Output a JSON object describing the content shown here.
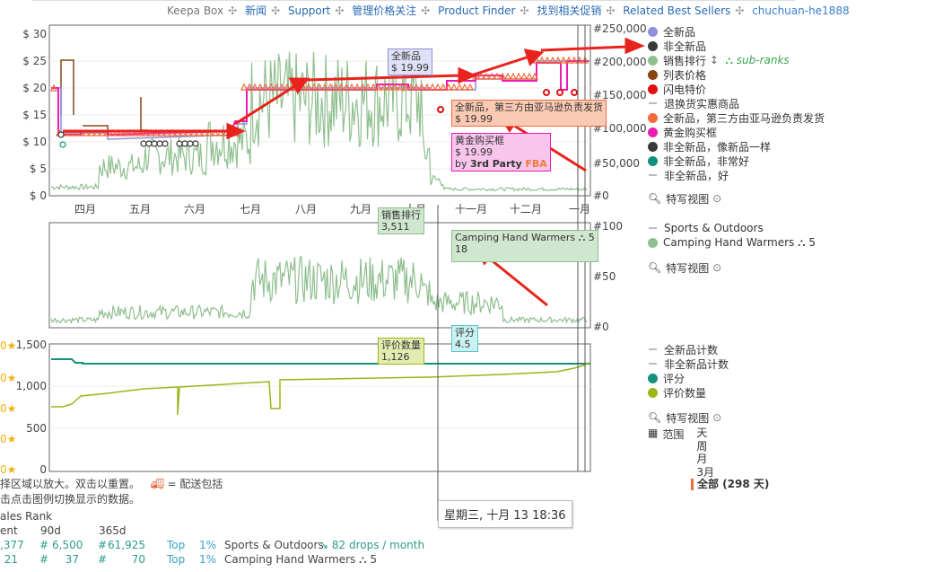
{
  "nav": {
    "items": [
      "Keepa Box",
      "新闻",
      "Support",
      "管理价格关注",
      "Product Finder",
      "找到相关促销",
      "Related Best Sellers",
      "chuchuan-he1888"
    ],
    "separator": "✣"
  },
  "price_chart": {
    "y_left": [
      "$ 30",
      "$ 25",
      "$ 20",
      "$ 15",
      "$ 10",
      "$ 5",
      "$ 0"
    ],
    "y_right": [
      "#250,000",
      "#200,000",
      "#150,000",
      "#100,000",
      "#50,000",
      "#0"
    ],
    "months": [
      "四月",
      "五月",
      "六月",
      "七月",
      "八月",
      "九月",
      "十月",
      "十一月",
      "十二月",
      "一月"
    ]
  },
  "rank_chart": {
    "y_right": [
      "#100",
      "#50",
      "#0"
    ]
  },
  "rating_chart": {
    "y_left": [
      "1,500",
      "1,000",
      "500",
      "0"
    ]
  },
  "tooltips": {
    "new": {
      "title": "全新品",
      "value": "$ 19.99"
    },
    "fba": {
      "title": "全新品，第三方由亚马逊负责发货",
      "value": "$ 19.99"
    },
    "buybox": {
      "title": "黄金购买框",
      "value": "$ 19.99",
      "by": "by",
      "seller": "3rd Party",
      "fba": "FBA"
    },
    "sales_rank": {
      "title": "销售排行",
      "value": "3,511"
    },
    "category": {
      "title": "Camping Hand Warmers",
      "value": "18",
      "sub": "5"
    },
    "rating": {
      "title": "评分",
      "value": "4.5"
    },
    "review_count": {
      "title": "评价数量",
      "value": "1,126"
    },
    "date": "星期三, 十月 13 18:36"
  },
  "legend_price": [
    {
      "label": "全新品",
      "color": "#8f8fdb",
      "type": "dot"
    },
    {
      "label": "非全新品",
      "color": "#3a3a3a",
      "type": "dot"
    },
    {
      "label": "销售排行",
      "color": "#8fbf8f",
      "type": "dot",
      "extra": "sub-ranks"
    },
    {
      "label": "列表价格",
      "color": "#8b4513",
      "type": "dot"
    },
    {
      "label": "闪电特价",
      "color": "#e01010",
      "type": "dot"
    },
    {
      "label": "退换货实惠商品",
      "type": "dash"
    },
    {
      "label": "全新品，第三方由亚马逊负责发货",
      "color": "#f26b3a",
      "type": "dot"
    },
    {
      "label": "黄金购买框",
      "color": "#ee1bb2",
      "type": "dot"
    },
    {
      "label": "非全新品，像新品一样",
      "color": "#3a3a3a",
      "type": "dot"
    },
    {
      "label": "非全新品，非常好",
      "color": "#10907a",
      "type": "dot"
    },
    {
      "label": "非全新品，好",
      "type": "dash"
    }
  ],
  "legend_rank": [
    {
      "label": "Sports & Outdoors",
      "type": "dash"
    },
    {
      "label": "Camping Hand Warmers",
      "color": "#8fbf8f",
      "type": "dot",
      "sub": "5"
    }
  ],
  "legend_rating": [
    {
      "label": "全新品计数",
      "type": "dash"
    },
    {
      "label": "非全新品计数",
      "type": "dash"
    },
    {
      "label": "评分",
      "color": "#14907c",
      "type": "dot"
    },
    {
      "label": "评价数量",
      "color": "#9bb51a",
      "type": "dot"
    }
  ],
  "close_up": "特写视图",
  "range": {
    "label": "范围",
    "options": [
      "天",
      "周",
      "月",
      "3月"
    ],
    "selected": "全部 (298 天)"
  },
  "help": {
    "line1": "择区域以放大。双击以重置。",
    "shipping": "= 配送包括",
    "line2": "击点击图例切换显示的数据。"
  },
  "sales_rank_table": {
    "title": "ales Rank",
    "headers": [
      "ent",
      "90d",
      "365d"
    ],
    "rows": [
      {
        "cur": ",377",
        "d90": "6,500",
        "d365": "61,925",
        "top": "Top",
        "pct": "1%",
        "cat": "Sports & Outdoors",
        "note": "82 drops / month"
      },
      {
        "cur": "21",
        "d90": "37",
        "d365": "70",
        "top": "Top",
        "pct": "1%",
        "cat": "Camping Hand Warmers",
        "sub": "5"
      }
    ]
  },
  "colors": {
    "teal": "#14907c",
    "olive": "#9bb51a",
    "rank": "#8fbf8f",
    "pink": "#ee1bb2",
    "orange": "#f26b3a",
    "red_arrow": "#e8231c"
  }
}
